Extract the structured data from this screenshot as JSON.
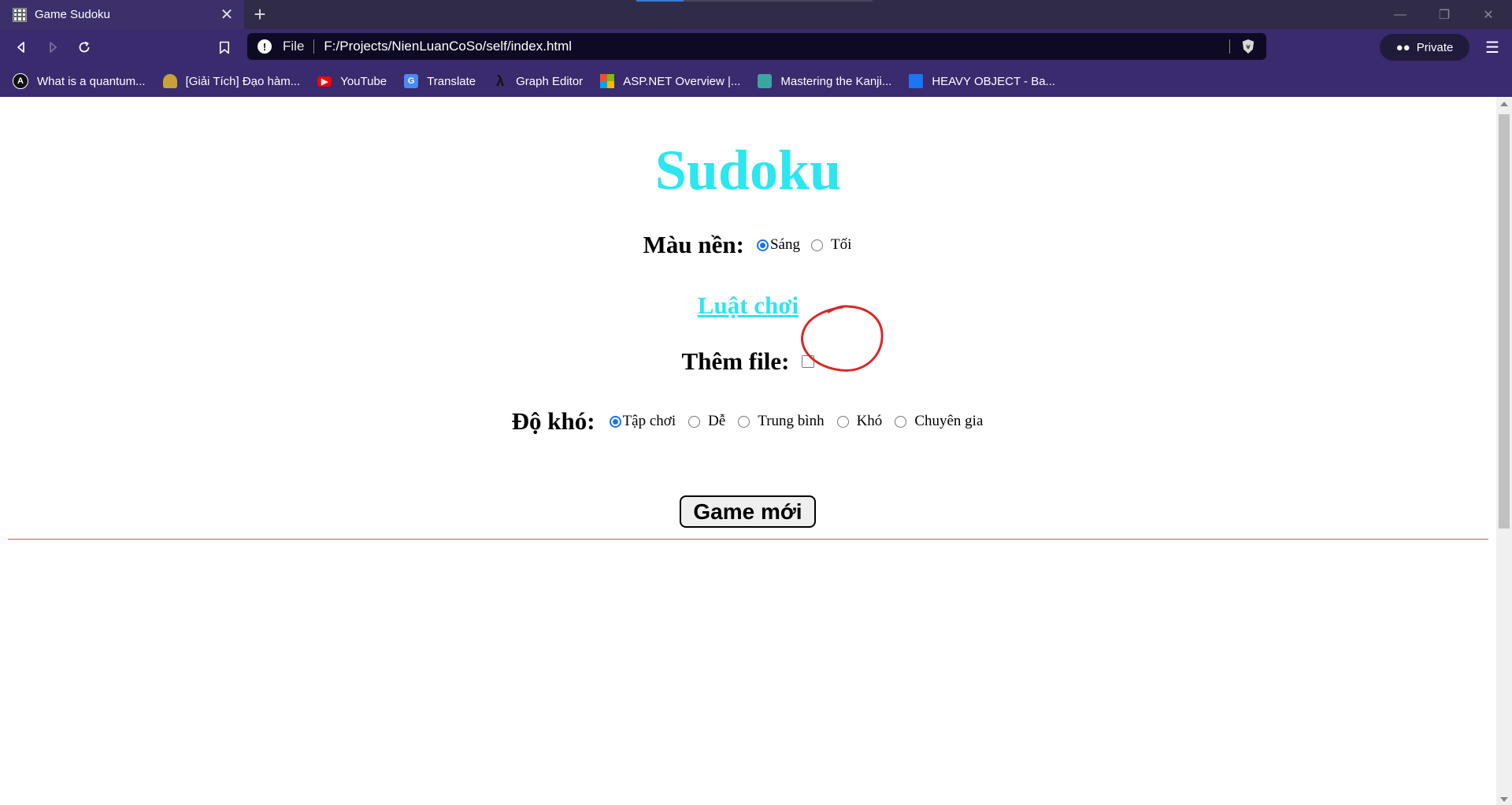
{
  "browser": {
    "tab_title": "Game Sudoku",
    "tab_close": "✕",
    "new_tab": "+",
    "url_scheme": "File",
    "url": "F:/Projects/NienLuanCoSo/self/index.html",
    "private_label": "Private",
    "bookmarks": [
      {
        "label": "What is a quantum...",
        "color": "#000000"
      },
      {
        "label": "[Giải Tích] Đạo hàm...",
        "color": "#c8a13a"
      },
      {
        "label": "YouTube",
        "color": "#ff0000"
      },
      {
        "label": "Translate",
        "color": "#4a8af4"
      },
      {
        "label": "Graph Editor",
        "color": "#222222"
      },
      {
        "label": "ASP.NET Overview |...",
        "color": "#f25022"
      },
      {
        "label": "Mastering the Kanji...",
        "color": "#3aa6a0"
      },
      {
        "label": "HEAVY OBJECT - Ba...",
        "color": "#1877f2"
      }
    ]
  },
  "page": {
    "title": "Sudoku",
    "bg_label": "Màu nền:",
    "bg_options": [
      {
        "label": "Sáng",
        "checked": true
      },
      {
        "label": "Tối",
        "checked": false
      }
    ],
    "rules_link": "Luật chơi",
    "add_file_label": "Thêm file:",
    "difficulty_label": "Độ khó:",
    "difficulty_options": [
      {
        "label": "Tập chơi",
        "checked": true
      },
      {
        "label": "Dễ",
        "checked": false
      },
      {
        "label": "Trung bình",
        "checked": false
      },
      {
        "label": "Khó",
        "checked": false
      },
      {
        "label": "Chuyên gia",
        "checked": false
      }
    ],
    "new_game_button": "Game mới",
    "accent_color": "#2ce6f0",
    "annotation_color": "#d62828"
  }
}
